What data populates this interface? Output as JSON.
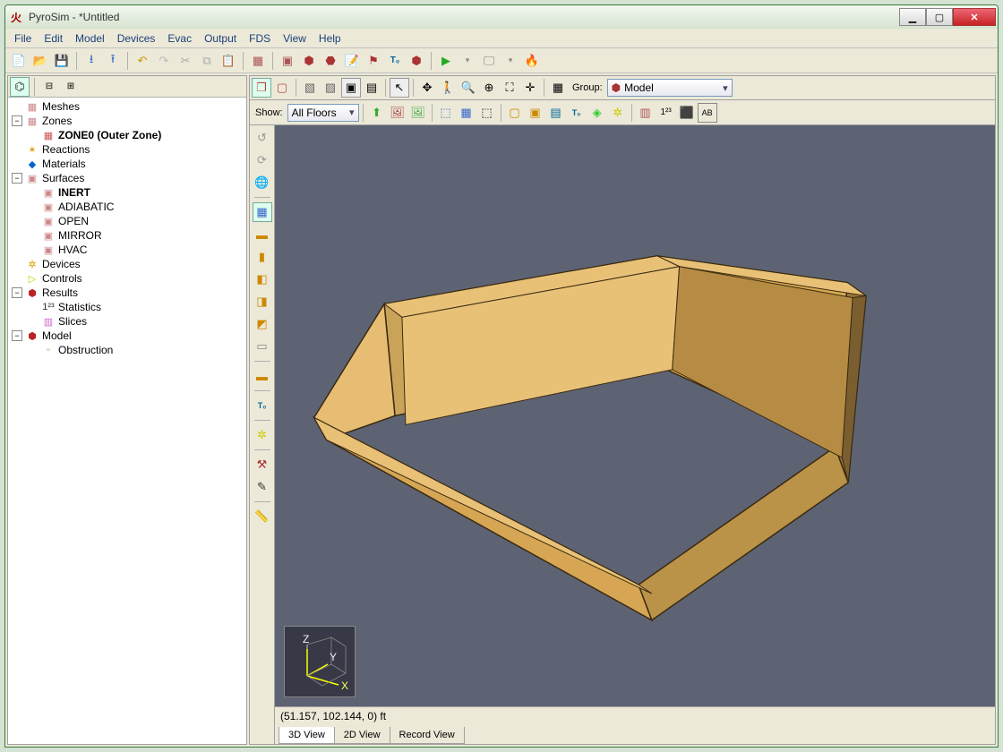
{
  "window": {
    "app_icon": "火",
    "title": "PyroSim - *Untitled"
  },
  "menu": [
    "File",
    "Edit",
    "Model",
    "Devices",
    "Evac",
    "Output",
    "FDS",
    "View",
    "Help"
  ],
  "tree": {
    "items": [
      {
        "depth": 0,
        "exp": "",
        "icon": "▦",
        "iconColor": "#c88",
        "label": "Meshes"
      },
      {
        "depth": 0,
        "exp": "−",
        "icon": "▦",
        "iconColor": "#c88",
        "label": "Zones"
      },
      {
        "depth": 1,
        "exp": "",
        "icon": "▦",
        "iconColor": "#c55",
        "label": "ZONE0 (Outer Zone)",
        "bold": true
      },
      {
        "depth": 0,
        "exp": "",
        "icon": "✶",
        "iconColor": "#d90",
        "label": "Reactions"
      },
      {
        "depth": 0,
        "exp": "",
        "icon": "◆",
        "iconColor": "#06c",
        "label": "Materials"
      },
      {
        "depth": 0,
        "exp": "−",
        "icon": "▣",
        "iconColor": "#c88",
        "label": "Surfaces"
      },
      {
        "depth": 1,
        "exp": "",
        "icon": "▣",
        "iconColor": "#c88",
        "label": "INERT",
        "bold": true
      },
      {
        "depth": 1,
        "exp": "",
        "icon": "▣",
        "iconColor": "#c88",
        "label": "ADIABATIC"
      },
      {
        "depth": 1,
        "exp": "",
        "icon": "▣",
        "iconColor": "#c88",
        "label": "OPEN"
      },
      {
        "depth": 1,
        "exp": "",
        "icon": "▣",
        "iconColor": "#c88",
        "label": "MIRROR"
      },
      {
        "depth": 1,
        "exp": "",
        "icon": "▣",
        "iconColor": "#c88",
        "label": "HVAC"
      },
      {
        "depth": 0,
        "exp": "",
        "icon": "✲",
        "iconColor": "#d90",
        "label": "Devices"
      },
      {
        "depth": 0,
        "exp": "",
        "icon": "▷",
        "iconColor": "#cc0",
        "label": "Controls"
      },
      {
        "depth": 0,
        "exp": "−",
        "icon": "⬢",
        "iconColor": "#b22",
        "label": "Results"
      },
      {
        "depth": 1,
        "exp": "",
        "icon": "1²³",
        "iconColor": "#333",
        "label": "Statistics"
      },
      {
        "depth": 1,
        "exp": "",
        "icon": "▥",
        "iconColor": "#c6c",
        "label": "Slices"
      },
      {
        "depth": 0,
        "exp": "−",
        "icon": "⬢",
        "iconColor": "#b22",
        "label": "Model"
      },
      {
        "depth": 1,
        "exp": "",
        "icon": "▫",
        "iconColor": "#c96",
        "label": "Obstruction"
      }
    ]
  },
  "view_toolbar": {
    "group_label": "Group:",
    "group_value": "Model",
    "show_label": "Show:",
    "show_value": "All Floors"
  },
  "status": {
    "coords": "(51.157, 102.144, 0) ft"
  },
  "view_tabs": [
    "3D View",
    "2D View",
    "Record View"
  ],
  "active_tab": "3D View",
  "axis": {
    "z": "Z",
    "y": "Y",
    "x": "X"
  }
}
